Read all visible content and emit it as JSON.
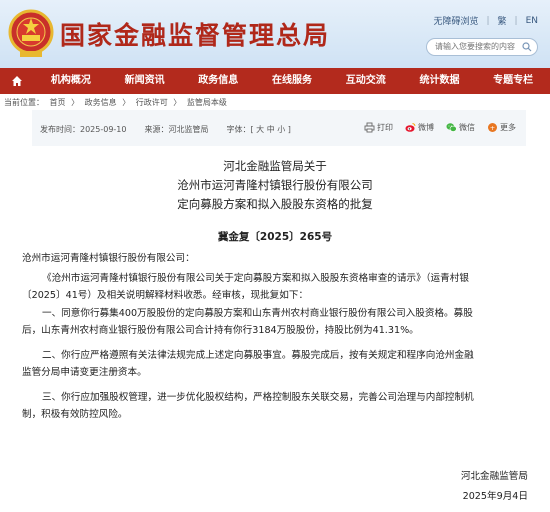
{
  "header": {
    "site_title": "国家金融监督管理总局",
    "top_links": [
      "无障碍浏览",
      "繁",
      "EN"
    ],
    "search_placeholder": "请输入您要搜索的内容"
  },
  "nav": {
    "items": [
      "机构概况",
      "新闻资讯",
      "政务信息",
      "在线服务",
      "互动交流",
      "统计数据",
      "专题专栏"
    ]
  },
  "breadcrumb": [
    "当前位置：",
    "首页",
    "〉",
    "政务信息",
    "〉",
    "行政许可",
    "〉",
    "监管局本级"
  ],
  "article_meta": {
    "date": "发布时间：2025-09-10",
    "source": "来源：河北监管局",
    "font": "字体：[ 大 中 小 ]",
    "print": "打印",
    "weibo": "微博",
    "wechat": "微信",
    "more": "更多"
  },
  "title": {
    "line1": "河北金融监管局关于",
    "line2": "沧州市运河青隆村镇银行股份有限公司",
    "line3": "定向募股方案和拟入股股东资格的批复"
  },
  "doc_no": "冀金复〔2025〕265号",
  "body": {
    "recipient": "沧州市运河青隆村镇银行股份有限公司：",
    "p1_l1": "《沧州市运河青隆村镇银行股份有限公司关于定向募股方案和拟入股股东资格审查的请示》（运青村银",
    "p1_l2": "〔2025〕41号）及相关说明解释材料收悉。经审核，现批复如下：",
    "p2_l1": "一、同意你行募集400万股股份的定向募股方案和山东青州农村商业银行股份有限公司入股资格。募股",
    "p2_l2": "后，山东青州农村商业银行股份有限公司合计持有你行3184万股股份，持股比例为41.31%。",
    "p3_l1": "二、你行应严格遵照有关法律法规完成上述定向募股事宜。募股完成后，按有关规定和程序向沧州金融",
    "p3_l2": "监管分局申请变更注册资本。",
    "p4_l1": "三、你行应加强股权管理，进一步优化股权结构，严格控制股东关联交易，完善公司治理与内部控制机",
    "p4_l2": "制，积极有效防控风险。"
  },
  "sign": {
    "org": "河北金融监管局",
    "date": "2025年9月4日"
  },
  "colors": {
    "brand_red": "#b32a1d",
    "header_bg": "#d6e6f5"
  }
}
